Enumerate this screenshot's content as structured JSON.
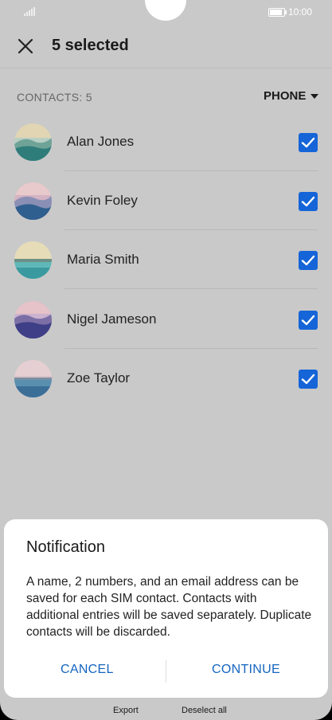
{
  "status": {
    "time": "10:00"
  },
  "header": {
    "title": "5 selected"
  },
  "list": {
    "count_label": "CONTACTS: 5",
    "filter_label": "PHONE",
    "contacts": [
      {
        "name": "Alan Jones",
        "checked": true
      },
      {
        "name": "Kevin Foley",
        "checked": true
      },
      {
        "name": "Maria Smith",
        "checked": true
      },
      {
        "name": "Nigel Jameson",
        "checked": true
      },
      {
        "name": "Zoe Taylor",
        "checked": true
      }
    ]
  },
  "bottom": {
    "export_label": "Export",
    "deselect_label": "Deselect all"
  },
  "dialog": {
    "title": "Notification",
    "body": "A name, 2 numbers, and an email address can be saved for each SIM contact. Contacts with additional entries will be saved separately. Duplicate contacts will be discarded.",
    "cancel_label": "CANCEL",
    "continue_label": "CONTINUE"
  },
  "colors": {
    "accent": "#1565d8",
    "button_text": "#1565c0"
  }
}
